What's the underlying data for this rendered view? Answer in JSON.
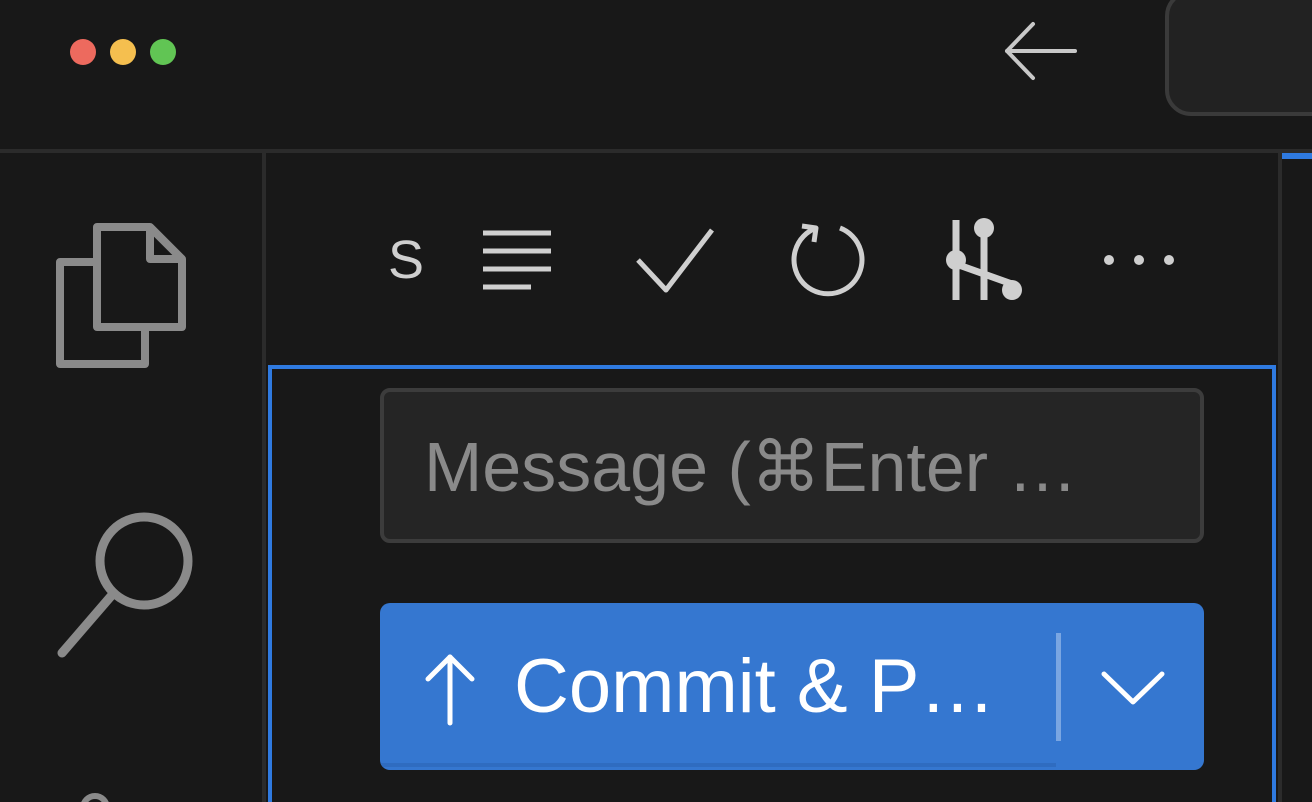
{
  "window": {
    "traffic_lights": [
      "close",
      "minimize",
      "maximize"
    ],
    "colors": {
      "close": "#ed6a5e",
      "minimize": "#f5bf4f",
      "maximize": "#61c554"
    }
  },
  "titlebar": {
    "back_icon": "arrow-left-icon"
  },
  "activity_bar": {
    "items": [
      {
        "icon": "files-icon",
        "name": "Explorer"
      },
      {
        "icon": "search-icon",
        "name": "Search"
      }
    ]
  },
  "scm": {
    "title_letter": "S",
    "toolbar": [
      {
        "icon": "view-as-list-icon"
      },
      {
        "icon": "checkmark-icon"
      },
      {
        "icon": "refresh-icon"
      },
      {
        "icon": "git-graph-icon"
      },
      {
        "icon": "more-actions-icon"
      }
    ],
    "message_placeholder": "Message (⌘Enter …",
    "commit_button_label": "Commit & P…",
    "commit_icon": "arrow-up-icon",
    "dropdown_icon": "chevron-down-icon",
    "accent_color": "#2f7ae0",
    "button_color": "#3577d0"
  }
}
